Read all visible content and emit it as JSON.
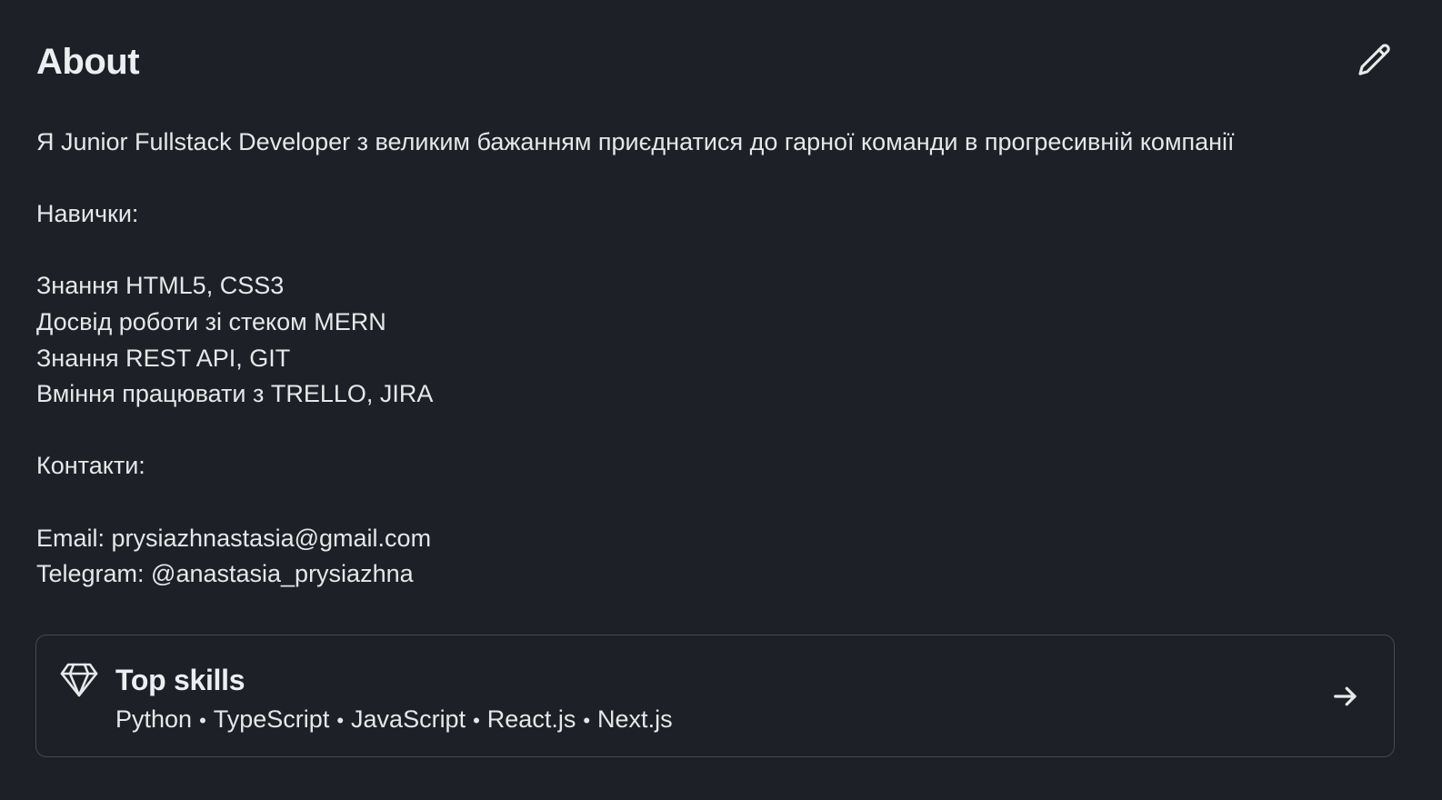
{
  "about": {
    "title": "About",
    "edit_icon": "pencil-icon",
    "intro": "Я Junior Fullstack Developer з великим бажанням приєднатися до гарної команди в прогресивній компанії",
    "skills_heading": "Навички:",
    "skills": [
      "Знання HTML5, CSS3",
      "Досвід роботи зі стеком MERN",
      "Знання REST API, GIT",
      "Вміння працювати з TRELLO, JIRA"
    ],
    "contacts_heading": "Контакти:",
    "contacts": [
      "Email: prysiazhnastasia@gmail.com",
      "Telegram: @anastasia_prysiazhna"
    ]
  },
  "top_skills": {
    "title": "Top skills",
    "icon": "diamond-icon",
    "arrow_icon": "arrow-right-icon",
    "items": [
      "Python",
      "TypeScript",
      "JavaScript",
      "React.js",
      "Next.js"
    ],
    "separator": "•"
  },
  "colors": {
    "background": "#1d2026",
    "text": "#e6e7e9",
    "card_border": "#454a52"
  }
}
